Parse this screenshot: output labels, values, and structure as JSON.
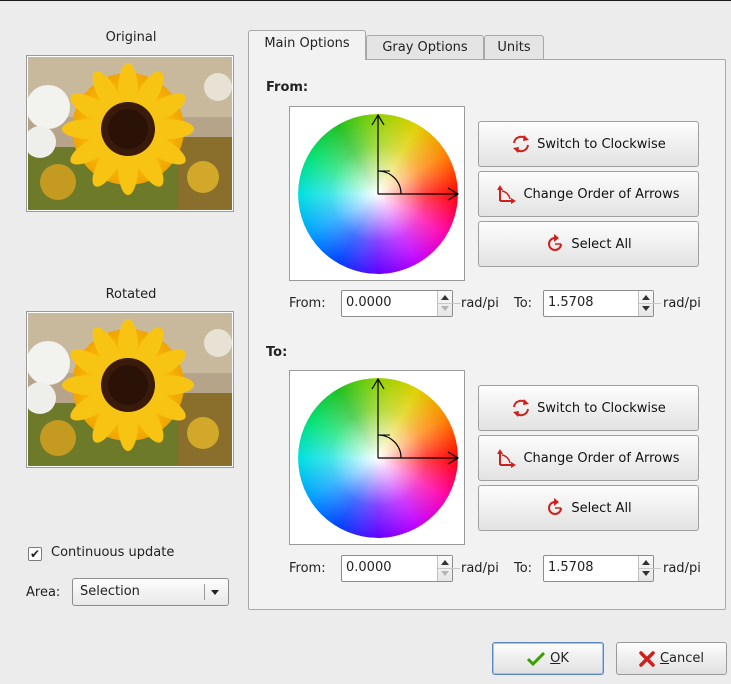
{
  "left": {
    "original_caption": "Original",
    "rotated_caption": "Rotated",
    "continuous_update_label": "Continuous update",
    "continuous_update_checked": true,
    "area_label": "Area:",
    "area_value": "Selection"
  },
  "tabs": [
    {
      "label": "Main Options",
      "active": true
    },
    {
      "label": "Gray Options",
      "active": false
    },
    {
      "label": "Units",
      "active": false
    }
  ],
  "from_section": {
    "title": "From:",
    "switch_label": "Switch to Clockwise",
    "change_order_label": "Change Order of Arrows",
    "select_all_label": "Select All",
    "from_label": "From:",
    "from_value": "0.0000",
    "to_label": "To:",
    "to_value": "1.5708",
    "unit_label": "rad/pi"
  },
  "to_section": {
    "title": "To:",
    "switch_label": "Switch to Clockwise",
    "change_order_label": "Change Order of Arrows",
    "select_all_label": "Select All",
    "from_label": "From:",
    "from_value": "0.0000",
    "to_label": "To:",
    "to_value": "1.5708",
    "unit_label": "rad/pi"
  },
  "footer": {
    "ok_label": "OK",
    "ok_mnemonic": "O",
    "ok_rest": "K",
    "cancel_label": "Cancel",
    "cancel_mnemonic": "C",
    "cancel_rest": "ancel"
  },
  "icons": {
    "switch": "rotate-arrows-icon",
    "change_order": "swap-arrows-icon",
    "select_all": "select-all-circle-icon",
    "ok": "checkmark-icon",
    "cancel": "red-x-icon"
  },
  "colors": {
    "icon_red": "#d0201b",
    "ok_green": "#3aa000",
    "default_border": "#5b86c4"
  }
}
